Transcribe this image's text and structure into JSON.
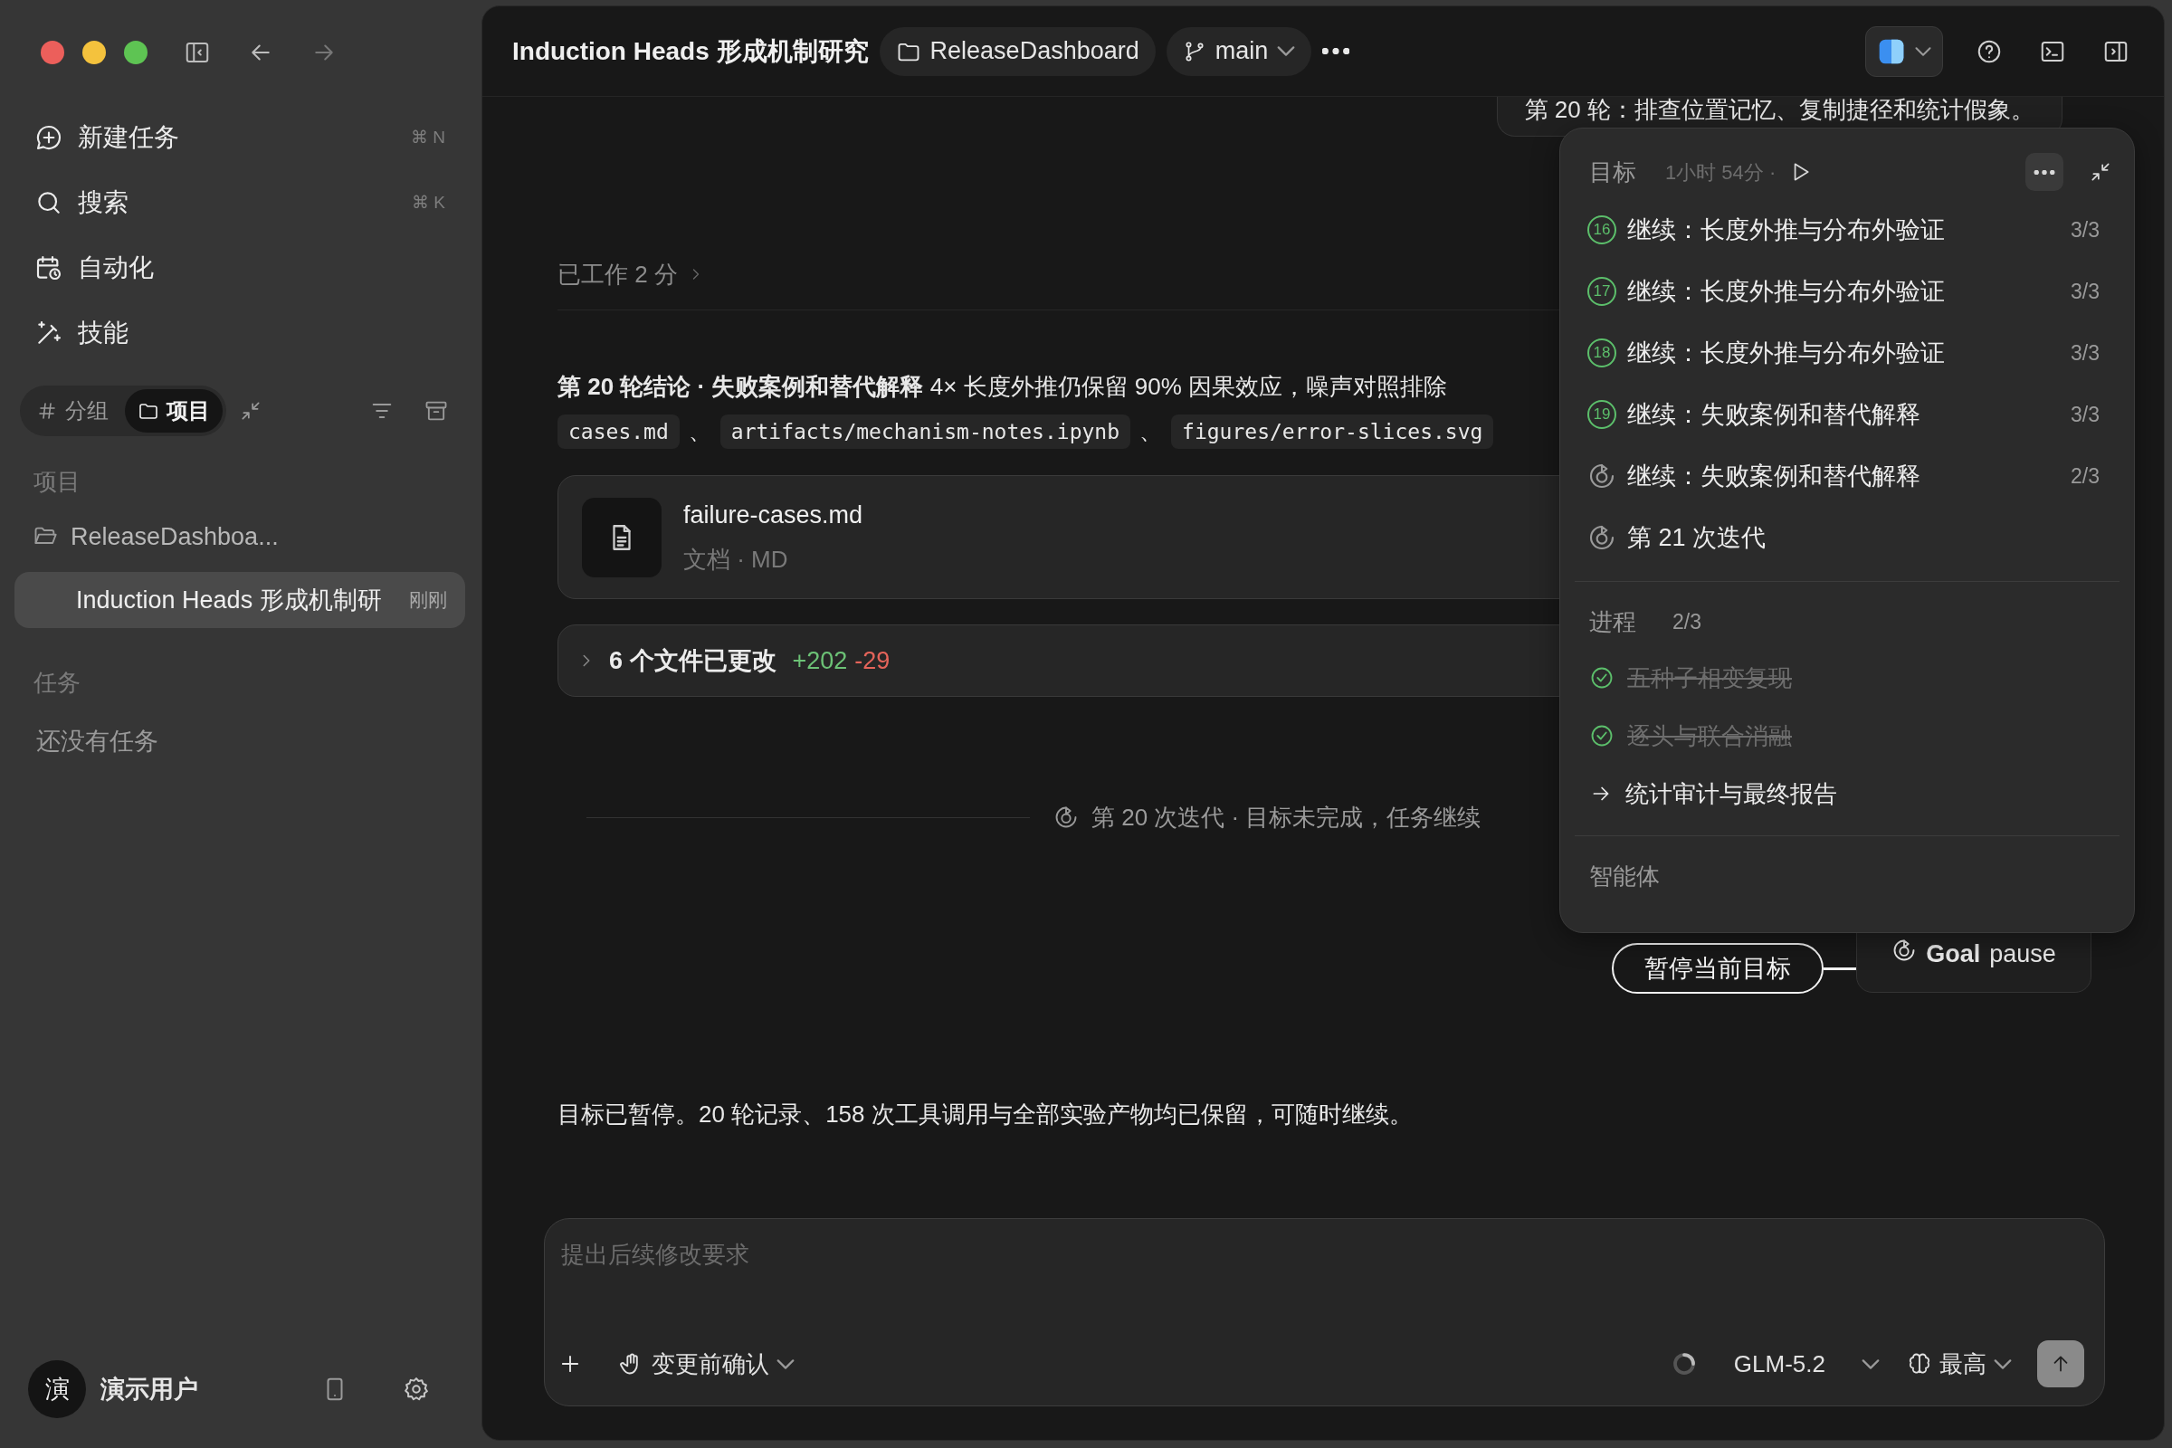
{
  "sidebar": {
    "nav": [
      {
        "label": "新建任务",
        "shortcut": "⌘ N",
        "kind": "new"
      },
      {
        "label": "搜索",
        "shortcut": "⌘ K",
        "kind": "search"
      },
      {
        "label": "自动化",
        "kind": "automation"
      },
      {
        "label": "技能",
        "kind": "skills"
      }
    ],
    "view_toggle": [
      {
        "label": "分组",
        "kind": "group",
        "selected": false
      },
      {
        "label": "项目",
        "kind": "project",
        "selected": true
      }
    ],
    "projects_heading": "项目",
    "projects": [
      {
        "name": "ReleaseDashboa...",
        "kind": "folder",
        "selected": false
      },
      {
        "name": "Induction Heads 形成机制研",
        "time": "刚刚",
        "kind": "task",
        "selected": true
      }
    ],
    "tasks_heading": "任务",
    "tasks_empty": "还没有任务",
    "user": {
      "avatar": "演",
      "name": "演示用户"
    }
  },
  "toolbar": {
    "title": "Induction Heads 形成机制研究",
    "project": "ReleaseDashboard",
    "branch": "main"
  },
  "chat": {
    "user_bubble": "第 20 轮：排查位置记忆、复制捷径和统计假象。",
    "worked": "已工作 2 分",
    "summary": "**第 20 轮结论 · 失败案例和替代解释** 4× 长度外推仍保留 90% 因果效应，噪声对照排除",
    "artifacts": [
      {
        "path": "cases.md",
        "after": "、"
      },
      {
        "path": "artifacts/mechanism-notes.ipynb",
        "after": "、"
      },
      {
        "path": "figures/error-slices.svg"
      }
    ],
    "file": {
      "name": "failure-cases.md",
      "meta": "文档 · MD"
    },
    "changes": {
      "label": "6 个文件已更改",
      "added": "+202",
      "removed": "-29",
      "expanded": false
    },
    "iteration": "第 20 次迭代 · 目标未完成，任务继续",
    "goal_button": {
      "title": "Goal",
      "action": "pause"
    },
    "callout": "暂停当前目标",
    "final": "目标已暂停。20 轮记录、158 次工具调用与全部实验产物均已保留，可随时继续。"
  },
  "goal_panel": {
    "title": "目标",
    "elapsed": "1小时 54分 ·",
    "items": [
      {
        "kind": "numbered",
        "badge": "16",
        "label": "继续：长度外推与分布外验证",
        "count": "3/3"
      },
      {
        "kind": "numbered",
        "badge": "17",
        "label": "继续：长度外推与分布外验证",
        "count": "3/3"
      },
      {
        "kind": "numbered",
        "badge": "18",
        "label": "继续：长度外推与分布外验证",
        "count": "3/3"
      },
      {
        "kind": "numbered",
        "badge": "19",
        "label": "继续：失败案例和替代解释",
        "count": "3/3"
      },
      {
        "kind": "running",
        "label": "继续：失败案例和替代解释",
        "count": "2/3"
      },
      {
        "kind": "running",
        "label": "第 21 次迭代"
      }
    ],
    "progress": {
      "title": "进程",
      "count": "2/3",
      "steps": [
        {
          "label": "五种子相变复现",
          "done": true
        },
        {
          "label": "逐头与联合消融",
          "done": true
        },
        {
          "label": "统计审计与最终报告",
          "done": false
        }
      ]
    },
    "agents_heading": "智能体"
  },
  "composer": {
    "placeholder": "提出后续修改要求",
    "approval": "变更前确认",
    "model": "GLM-5.2",
    "effort": "最高"
  }
}
